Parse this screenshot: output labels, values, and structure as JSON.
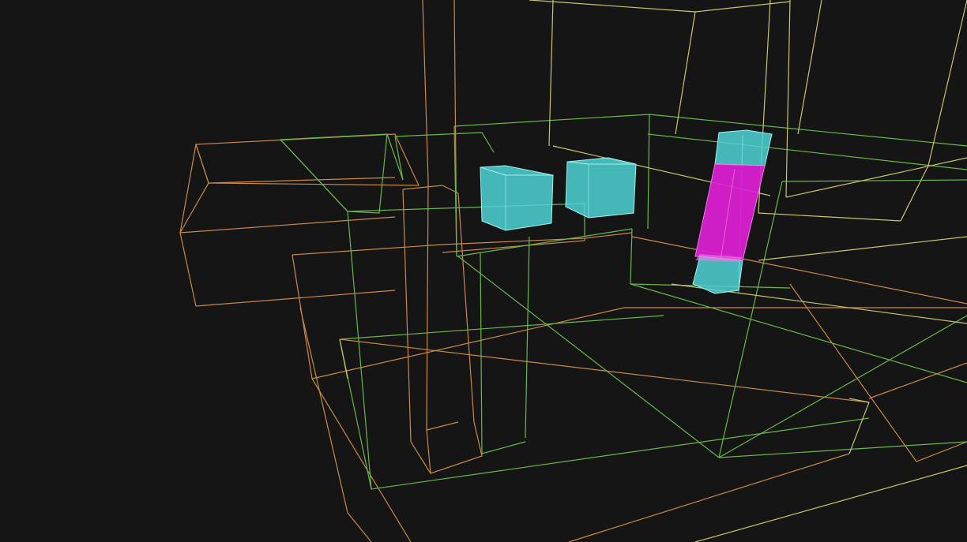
{
  "scene": {
    "background": "#151515",
    "colors": {
      "orange_wire": "#c98a4a",
      "green_wire": "#69b84a",
      "yellow_wire": "#c9c46e",
      "cyan_volume": "#4fd3d6",
      "magenta_volume": "#e01fd6"
    },
    "objects": [
      {
        "name": "orange-wireframe-block",
        "kind": "wireframe",
        "color": "orange"
      },
      {
        "name": "green-wireframe-block",
        "kind": "wireframe",
        "color": "green"
      },
      {
        "name": "yellow-wireframe-block",
        "kind": "wireframe",
        "color": "yellow"
      },
      {
        "name": "cyan-cube-left",
        "kind": "solid",
        "color": "cyan"
      },
      {
        "name": "cyan-cube-middle",
        "kind": "solid",
        "color": "cyan"
      },
      {
        "name": "cyan-pillar-right",
        "kind": "solid",
        "color": "cyan"
      },
      {
        "name": "magenta-pillar-segment",
        "kind": "solid",
        "color": "magenta"
      }
    ]
  }
}
